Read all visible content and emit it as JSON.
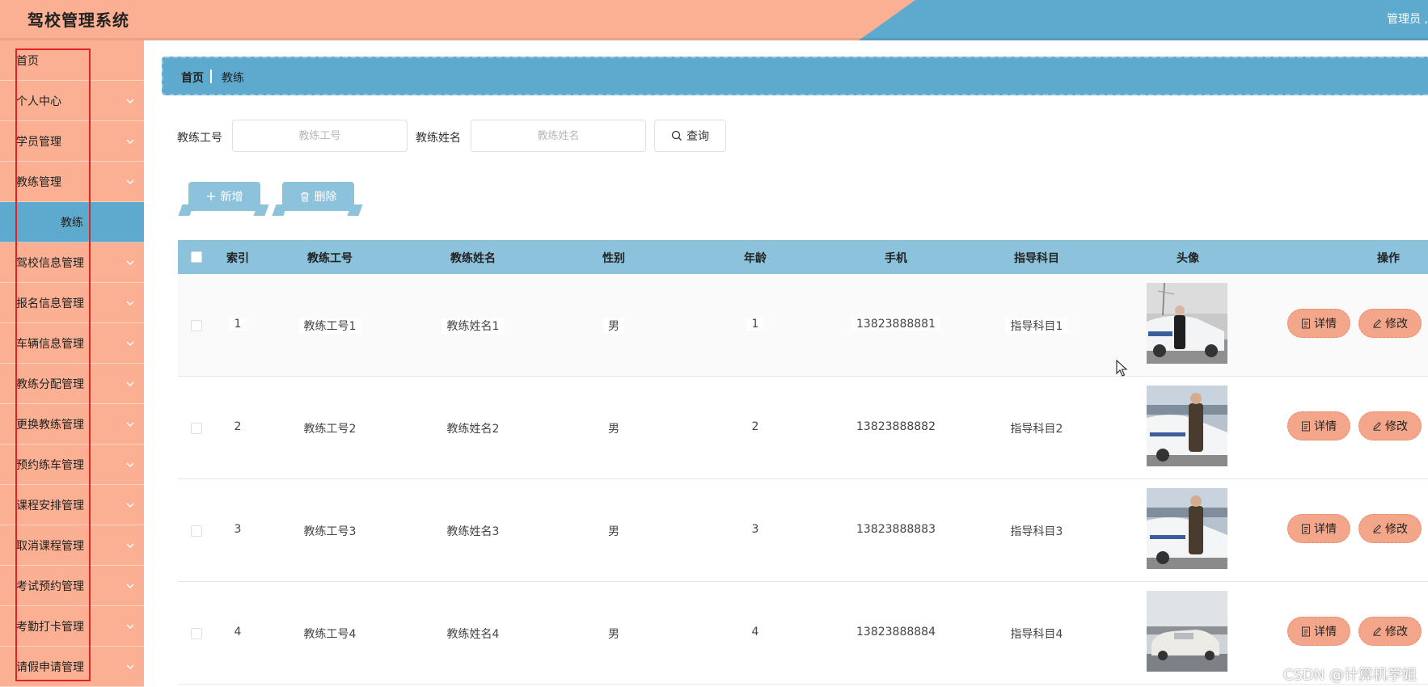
{
  "header": {
    "title": "驾校管理系统",
    "user": "管理员 ,"
  },
  "sidebar": {
    "items": [
      {
        "label": "首页",
        "chevron": false
      },
      {
        "label": "个人中心",
        "chevron": true
      },
      {
        "label": "学员管理",
        "chevron": true
      },
      {
        "label": "教练管理",
        "chevron": true
      },
      {
        "label": "教练",
        "chevron": false,
        "active": true
      },
      {
        "label": "驾校信息管理",
        "chevron": true
      },
      {
        "label": "报名信息管理",
        "chevron": true
      },
      {
        "label": "车辆信息管理",
        "chevron": true
      },
      {
        "label": "教练分配管理",
        "chevron": true
      },
      {
        "label": "更换教练管理",
        "chevron": true
      },
      {
        "label": "预约练车管理",
        "chevron": true
      },
      {
        "label": "课程安排管理",
        "chevron": true
      },
      {
        "label": "取消课程管理",
        "chevron": true
      },
      {
        "label": "考试预约管理",
        "chevron": true
      },
      {
        "label": "考勤打卡管理",
        "chevron": true
      },
      {
        "label": "请假申请管理",
        "chevron": true
      }
    ]
  },
  "breadcrumb": {
    "home": "首页",
    "current": "教练"
  },
  "search": {
    "id_label": "教练工号",
    "id_placeholder": "教练工号",
    "name_label": "教练姓名",
    "name_placeholder": "教练姓名",
    "query_label": "查询"
  },
  "actions": {
    "add_label": "新增",
    "delete_label": "删除"
  },
  "table": {
    "columns": [
      "索引",
      "教练工号",
      "教练姓名",
      "性别",
      "年龄",
      "手机",
      "指导科目",
      "头像",
      "操作"
    ],
    "detail_label": "详情",
    "edit_label": "修改",
    "rows": [
      {
        "index": "1",
        "id": "教练工号1",
        "name": "教练姓名1",
        "gender": "男",
        "age": "1",
        "phone": "13823888881",
        "subject": "指导科目1"
      },
      {
        "index": "2",
        "id": "教练工号2",
        "name": "教练姓名2",
        "gender": "男",
        "age": "2",
        "phone": "13823888882",
        "subject": "指导科目2"
      },
      {
        "index": "3",
        "id": "教练工号3",
        "name": "教练姓名3",
        "gender": "男",
        "age": "3",
        "phone": "13823888883",
        "subject": "指导科目3"
      },
      {
        "index": "4",
        "id": "教练工号4",
        "name": "教练姓名4",
        "gender": "男",
        "age": "4",
        "phone": "13823888884",
        "subject": "指导科目4"
      }
    ]
  },
  "watermark": "CSDN @计算机学姐",
  "colors": {
    "peach": "#fbb093",
    "blue": "#5eaacf",
    "light_blue": "#8cc2dc",
    "pill": "#f3a68a"
  }
}
